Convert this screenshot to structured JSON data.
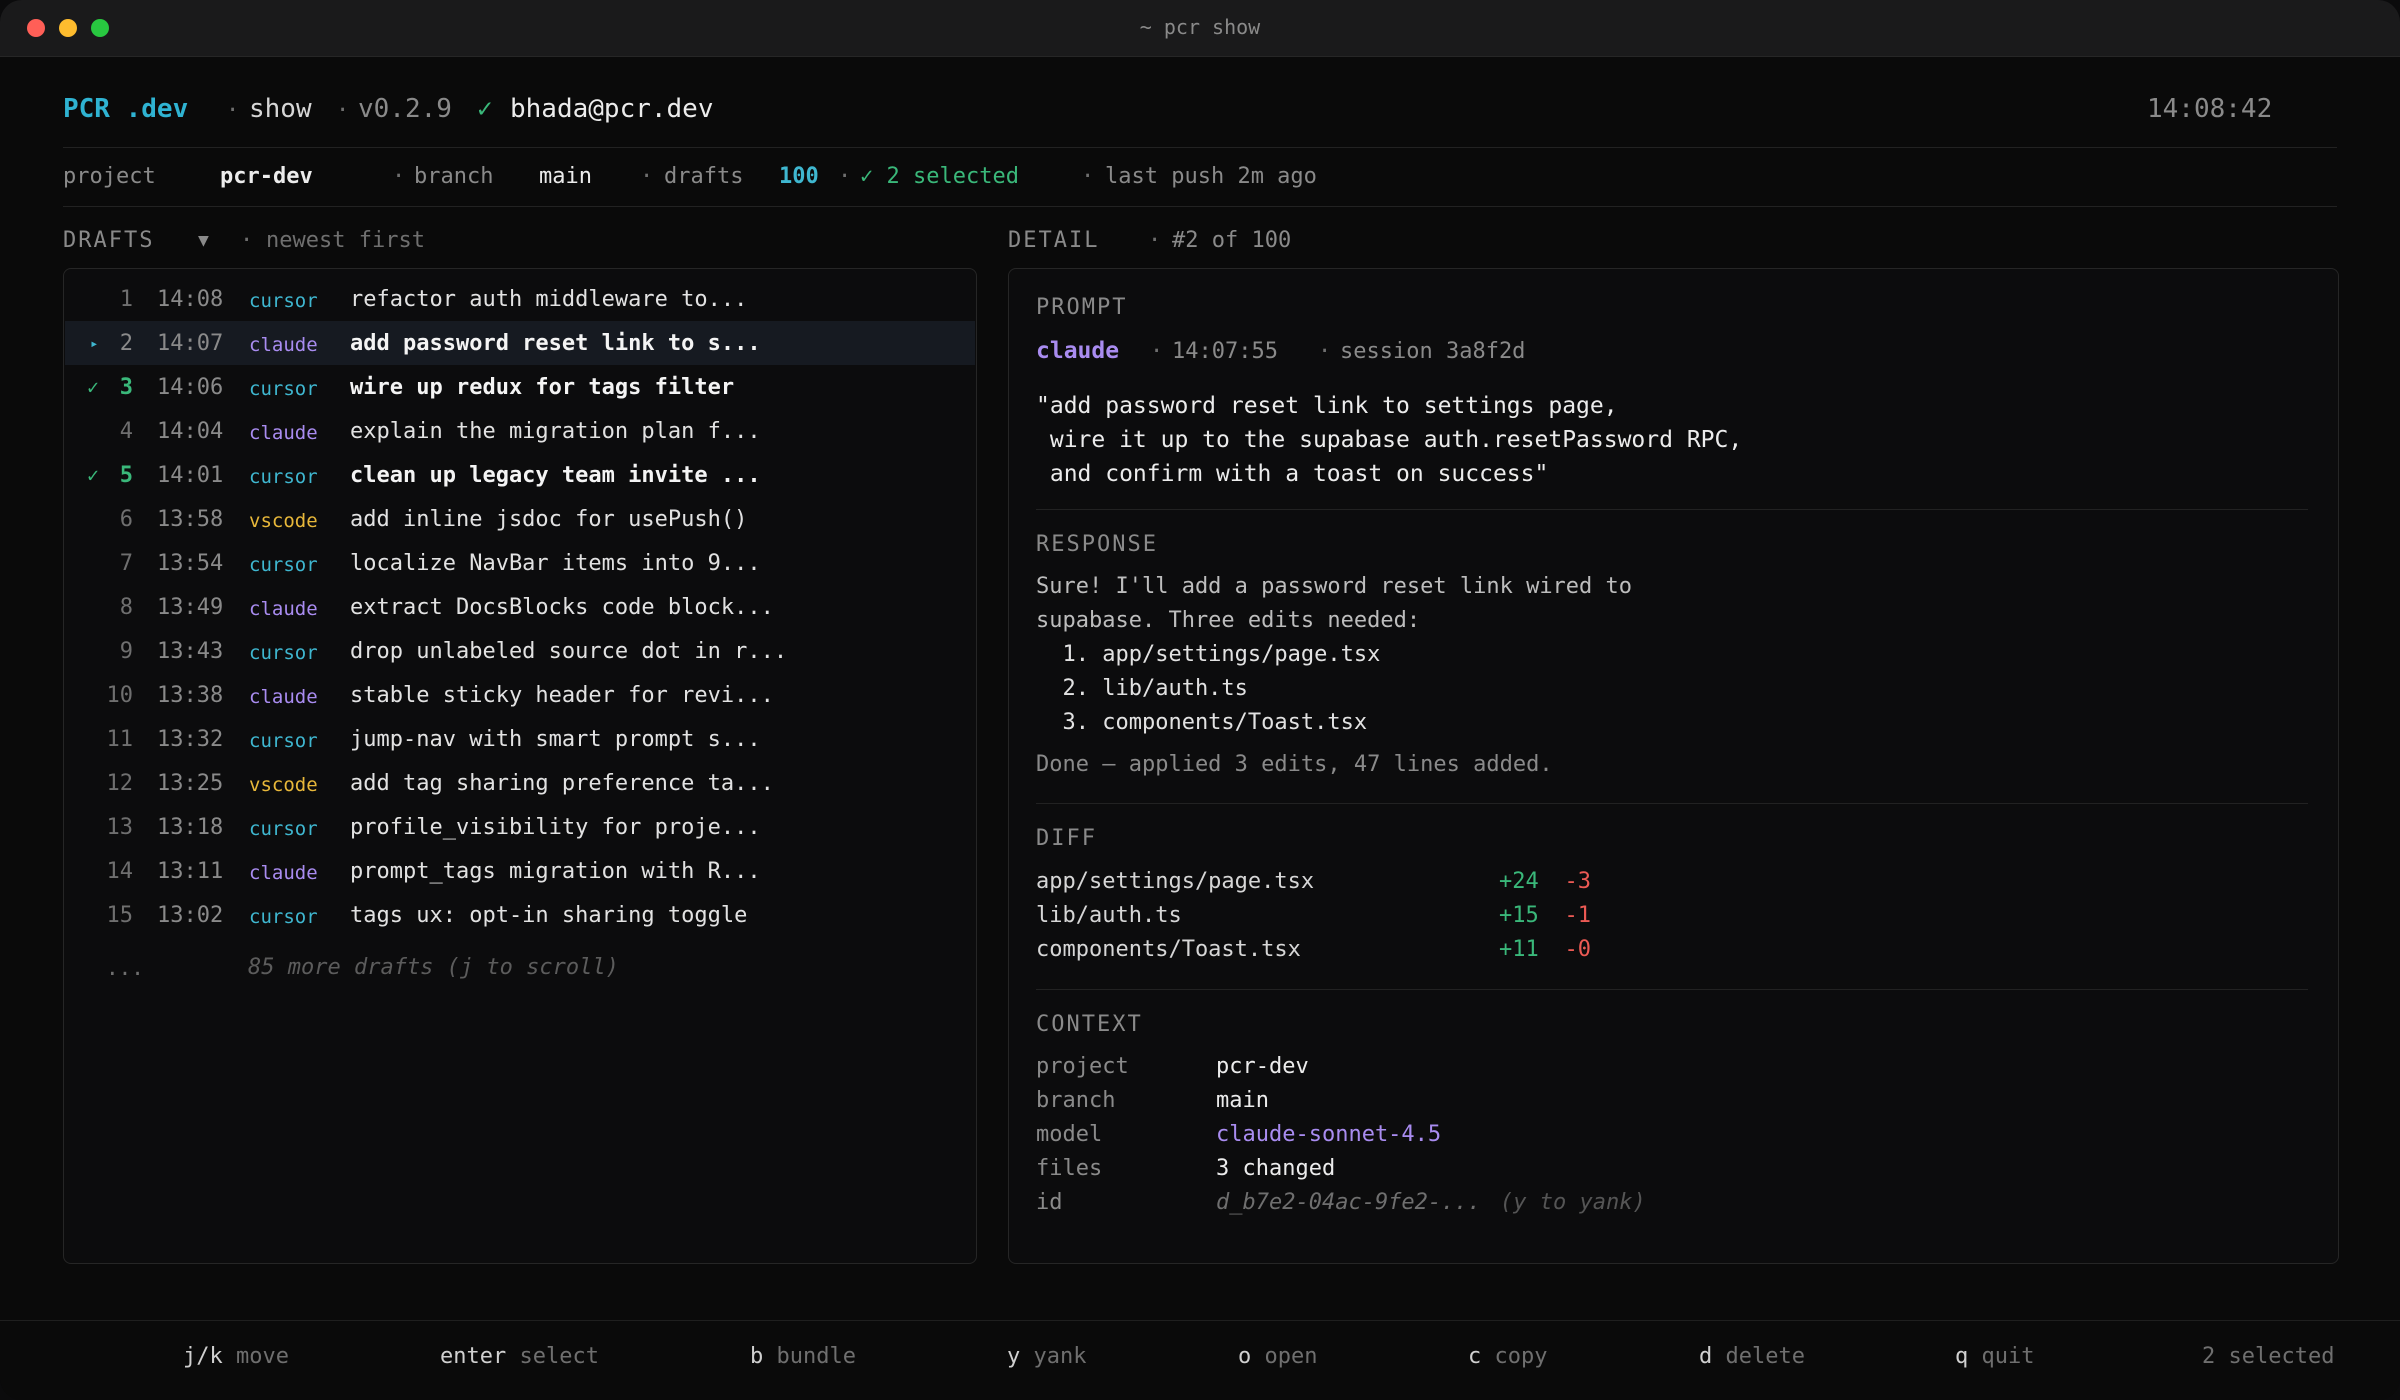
{
  "window": {
    "title": "~ pcr show"
  },
  "header": {
    "brand_a": "PCR",
    "brand_b": ".dev",
    "command": "show",
    "version": "v0.2.9",
    "user": "bhada@pcr.dev",
    "clock": "14:08:42"
  },
  "meta": {
    "project_label": "project",
    "project_value": "pcr-dev",
    "branch_label": "branch",
    "branch_value": "main",
    "drafts_label": "drafts",
    "drafts_value": "100",
    "selected": "✓ 2 selected",
    "last_push": "last push 2m ago"
  },
  "drafts": {
    "title": "DRAFTS",
    "sort_icon": "▼",
    "sort_label": "newest first",
    "more": "85 more drafts (j to scroll)",
    "more_dots": "...",
    "rows": [
      {
        "num": "1",
        "time": "14:08",
        "src": "cursor",
        "text": "refactor auth middleware to...",
        "state": "none"
      },
      {
        "num": "2",
        "time": "14:07",
        "src": "claude",
        "text": "add password reset link to s...",
        "state": "active"
      },
      {
        "num": "3",
        "time": "14:06",
        "src": "cursor",
        "text": "wire up redux for tags filter",
        "state": "checked"
      },
      {
        "num": "4",
        "time": "14:04",
        "src": "claude",
        "text": "explain the migration plan f...",
        "state": "none"
      },
      {
        "num": "5",
        "time": "14:01",
        "src": "cursor",
        "text": "clean up legacy team invite ...",
        "state": "checked"
      },
      {
        "num": "6",
        "time": "13:58",
        "src": "vscode",
        "text": "add inline jsdoc for usePush()",
        "state": "none"
      },
      {
        "num": "7",
        "time": "13:54",
        "src": "cursor",
        "text": "localize NavBar items into 9...",
        "state": "none"
      },
      {
        "num": "8",
        "time": "13:49",
        "src": "claude",
        "text": "extract DocsBlocks code block...",
        "state": "none"
      },
      {
        "num": "9",
        "time": "13:43",
        "src": "cursor",
        "text": "drop unlabeled source dot in r...",
        "state": "none"
      },
      {
        "num": "10",
        "time": "13:38",
        "src": "claude",
        "text": "stable sticky header for revi...",
        "state": "none"
      },
      {
        "num": "11",
        "time": "13:32",
        "src": "cursor",
        "text": "jump-nav with smart prompt s...",
        "state": "none"
      },
      {
        "num": "12",
        "time": "13:25",
        "src": "vscode",
        "text": "add tag sharing preference ta...",
        "state": "none"
      },
      {
        "num": "13",
        "time": "13:18",
        "src": "cursor",
        "text": "profile_visibility for proje...",
        "state": "none"
      },
      {
        "num": "14",
        "time": "13:11",
        "src": "claude",
        "text": "prompt_tags migration with R...",
        "state": "none"
      },
      {
        "num": "15",
        "time": "13:02",
        "src": "cursor",
        "text": "tags ux: opt-in sharing toggle",
        "state": "none"
      }
    ]
  },
  "detail": {
    "title": "DETAIL",
    "position": "#2 of 100",
    "prompt_label": "PROMPT",
    "agent": "claude",
    "time": "14:07:55",
    "session": "session 3a8f2d",
    "prompt_lines": [
      "\"add password reset link to settings page,",
      " wire it up to the supabase auth.resetPassword RPC,",
      " and confirm with a toast on success\""
    ],
    "response_label": "RESPONSE",
    "response_lines": [
      "Sure! I'll add a password reset link wired to",
      "supabase. Three edits needed:",
      "  1. app/settings/page.tsx",
      "  2. lib/auth.ts",
      "  3. components/Toast.tsx"
    ],
    "response_done": "Done — applied 3 edits, 47 lines added.",
    "diff_label": "DIFF",
    "diff": [
      {
        "file": "app/settings/page.tsx",
        "add": "+24",
        "del": "-3"
      },
      {
        "file": "lib/auth.ts",
        "add": "+15",
        "del": "-1"
      },
      {
        "file": "components/Toast.tsx",
        "add": "+11",
        "del": "-0"
      }
    ],
    "context_label": "CONTEXT",
    "context": [
      {
        "key": "project",
        "value": "pcr-dev"
      },
      {
        "key": "branch",
        "value": "main"
      },
      {
        "key": "model",
        "value": "claude-sonnet-4.5"
      },
      {
        "key": "files",
        "value": "3 changed"
      },
      {
        "key": "id",
        "value": "d_b7e2-04ac-9fe2-...",
        "hint": "(y to yank)"
      }
    ]
  },
  "footer": {
    "keys": [
      {
        "key": "j/k",
        "action": "move"
      },
      {
        "key": "enter",
        "action": "select"
      },
      {
        "key": "b",
        "action": "bundle"
      },
      {
        "key": "y",
        "action": "yank"
      },
      {
        "key": "o",
        "action": "open"
      },
      {
        "key": "c",
        "action": "copy"
      },
      {
        "key": "d",
        "action": "delete"
      },
      {
        "key": "q",
        "action": "quit"
      }
    ],
    "status": "2 selected"
  },
  "colors": {
    "cursor": "#3fb7d0",
    "claude": "#a98cf0",
    "vscode": "#e8b83a",
    "check": "#3ab87a",
    "add": "#3ab87a",
    "del": "#ec5a54"
  }
}
